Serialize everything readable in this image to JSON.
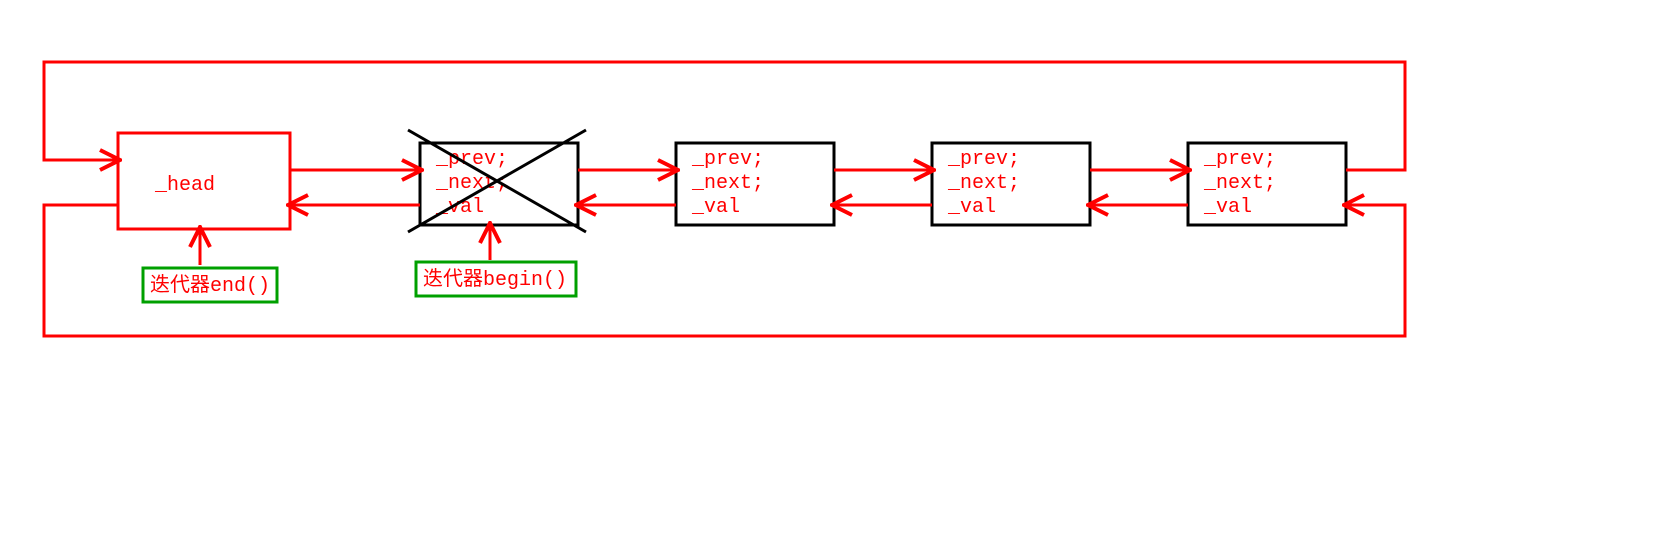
{
  "diagram": {
    "head": {
      "label": "_head"
    },
    "node": {
      "line1": "_prev;",
      "line2": "_next;",
      "line3": "_val"
    },
    "iterator_end_label": "迭代器end()",
    "iterator_begin_label": "迭代器begin()"
  },
  "colors": {
    "link": "#ff0000",
    "node_border": "#000000",
    "head_border": "#ff0000",
    "legend_border": "#00a000",
    "text": "#ff0000"
  }
}
